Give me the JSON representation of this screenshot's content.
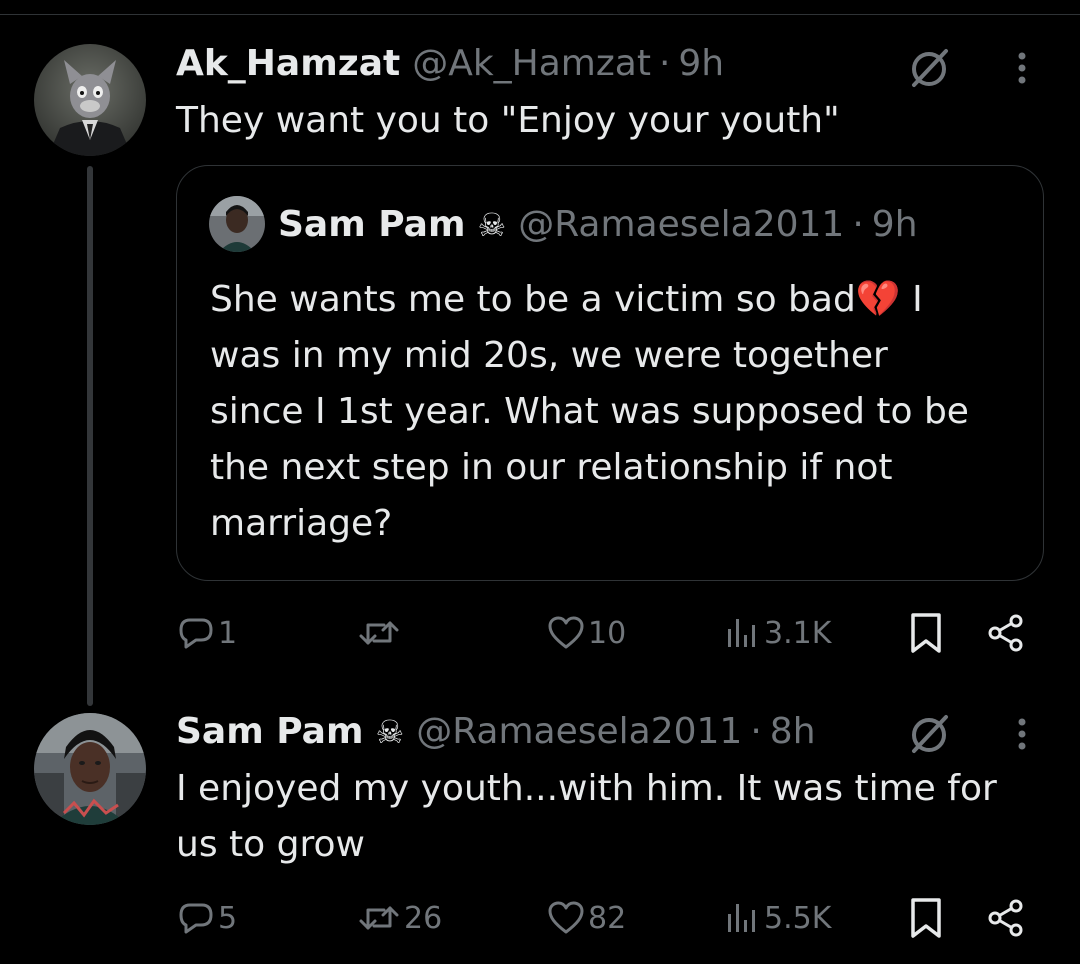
{
  "tweets": [
    {
      "name": "Ak_Hamzat",
      "handle": "@Ak_Hamzat",
      "separator": "·",
      "time": "9h",
      "text": "They want you to \"Enjoy your youth\"",
      "quote": {
        "name": "Sam Pam",
        "badge": "☠",
        "handle": "@Ramaesela2011",
        "separator": "·",
        "time": "9h",
        "text_lines": [
          "She wants me to be a victim so bad💔 I",
          "was in my mid 20s, we were together",
          "since I 1st year. What was supposed to be",
          "the next step in our relationship if not",
          "marriage?"
        ]
      },
      "actions": {
        "replies": "1",
        "reposts": "",
        "likes": "10",
        "views": "3.1K"
      }
    },
    {
      "name": "Sam Pam",
      "badge": "☠",
      "handle": "@Ramaesela2011",
      "separator": "·",
      "time": "8h",
      "text_lines": [
        "I enjoyed my youth...with him. It was time for",
        "us to grow"
      ],
      "actions": {
        "replies": "5",
        "reposts": "26",
        "likes": "82",
        "views": "5.5K"
      }
    }
  ],
  "icons": {
    "reply": "reply-icon",
    "repost": "repost-icon",
    "like": "heart-icon",
    "views": "views-icon",
    "bookmark": "bookmark-icon",
    "share": "share-icon",
    "grok": "grok-icon",
    "more": "more-icon"
  },
  "colors": {
    "background": "#000000",
    "text": "#e7e9ea",
    "secondary": "#71767b",
    "border": "#2f3336"
  }
}
